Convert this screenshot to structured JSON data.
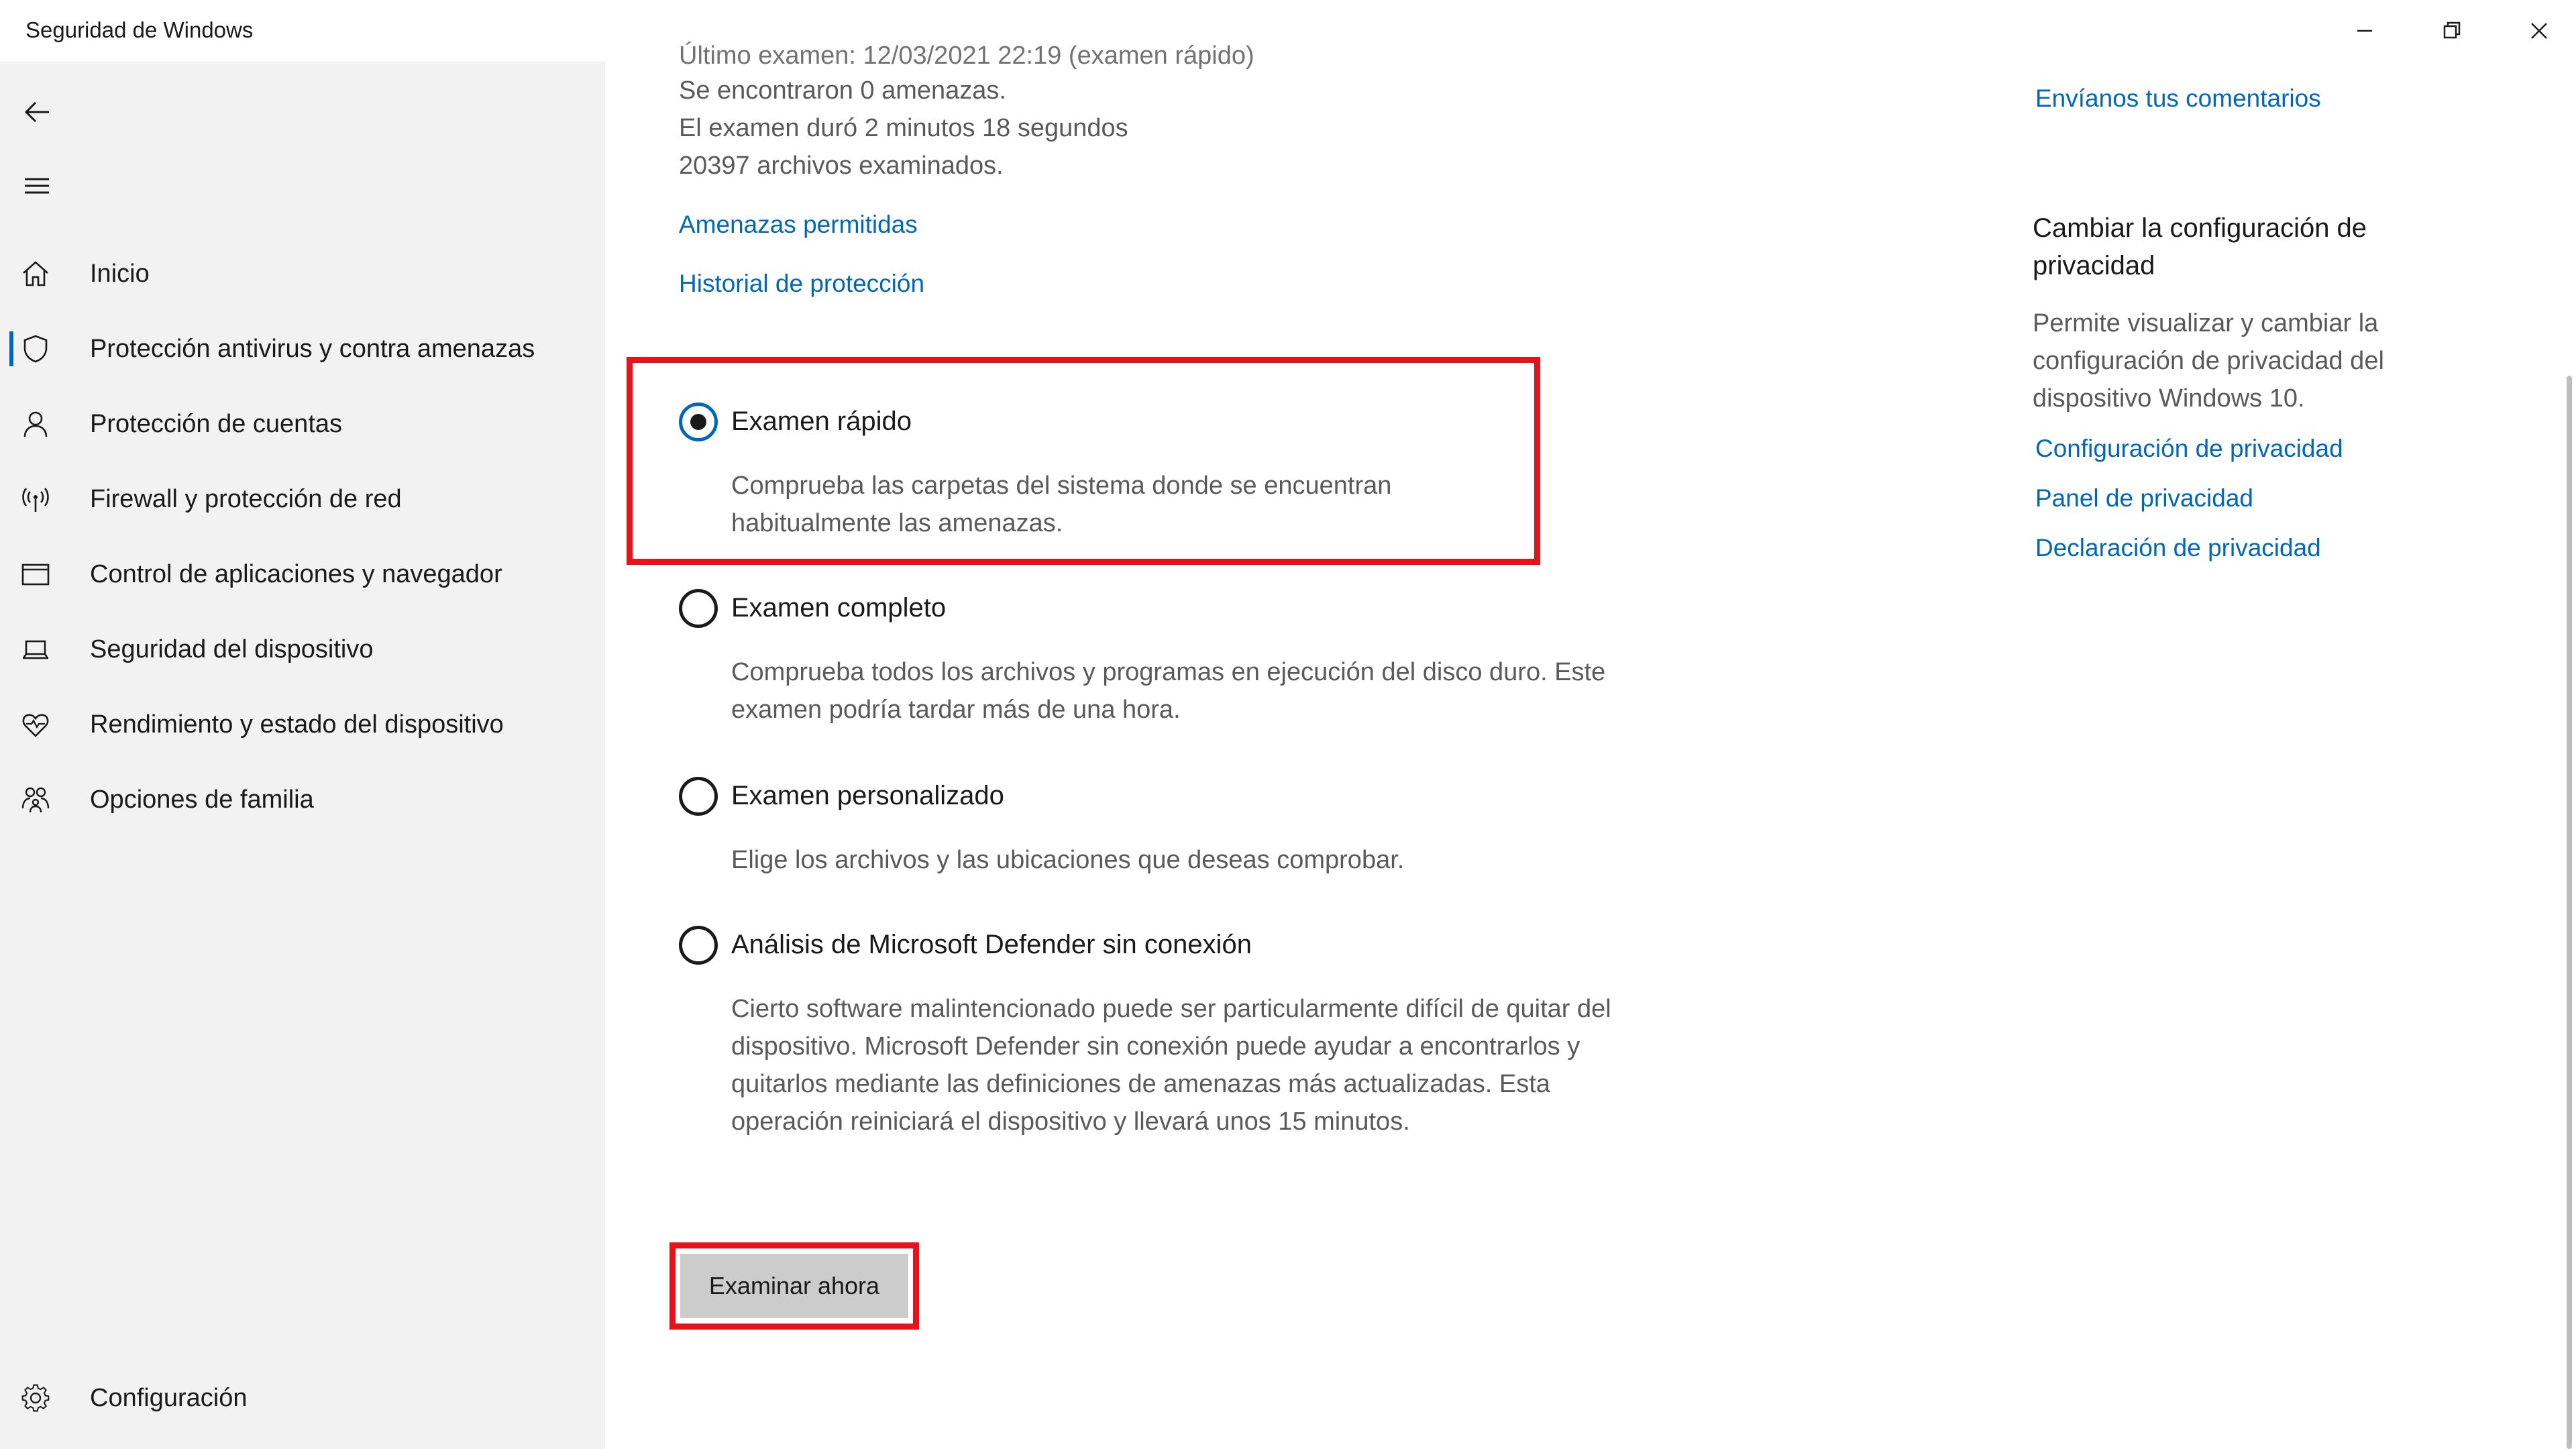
{
  "window": {
    "title": "Seguridad de Windows"
  },
  "sidebar": {
    "items": [
      {
        "label": "Inicio",
        "icon": "home-icon"
      },
      {
        "label": "Protección antivirus y contra amenazas",
        "icon": "shield-icon"
      },
      {
        "label": "Protección de cuentas",
        "icon": "person-icon"
      },
      {
        "label": "Firewall y protección de red",
        "icon": "wireless-icon"
      },
      {
        "label": "Control de aplicaciones y navegador",
        "icon": "browser-window-icon"
      },
      {
        "label": "Seguridad del dispositivo",
        "icon": "laptop-icon"
      },
      {
        "label": "Rendimiento y estado del dispositivo",
        "icon": "heart-pulse-icon"
      },
      {
        "label": "Opciones de familia",
        "icon": "family-icon"
      }
    ],
    "settings_label": "Configuración"
  },
  "main": {
    "scan_info": {
      "last_scan_partial": "Último examen: 12/03/2021 22:19 (examen rápido)",
      "threats_found": "Se encontraron 0 amenazas.",
      "duration": "El examen duró 2 minutos 18 segundos",
      "files_scanned": "20397 archivos examinados."
    },
    "links": {
      "allowed_threats": "Amenazas permitidas",
      "protection_history": "Historial de protección"
    },
    "options": [
      {
        "label": "Examen rápido",
        "description": "Comprueba las carpetas del sistema donde se encuentran habitualmente las amenazas.",
        "selected": true
      },
      {
        "label": "Examen completo",
        "description": "Comprueba todos los archivos y programas en ejecución del disco duro. Este examen podría tardar más de una hora.",
        "selected": false
      },
      {
        "label": "Examen personalizado",
        "description": "Elige los archivos y las ubicaciones que deseas comprobar.",
        "selected": false
      },
      {
        "label": "Análisis de Microsoft Defender sin conexión",
        "description": "Cierto software malintencionado puede ser particularmente difícil de quitar del dispositivo. Microsoft Defender sin conexión puede ayudar a encontrarlos y quitarlos mediante las definiciones de amenazas más actualizadas. Esta operación reiniciará el dispositivo y llevará unos 15 minutos.",
        "selected": false
      }
    ],
    "scan_button_label": "Examinar ahora"
  },
  "right_panel": {
    "feedback_link": "Envíanos tus comentarios",
    "privacy_heading": "Cambiar la configuración de privacidad",
    "privacy_description": "Permite visualizar y cambiar la configuración de privacidad del dispositivo Windows 10.",
    "privacy_links": [
      "Configuración de privacidad",
      "Panel de privacidad",
      "Declaración de privacidad"
    ]
  },
  "colors": {
    "accent": "#0067c0",
    "highlight": "#e8121b",
    "sidebar_bg": "#f2f2f2",
    "button_bg": "#cccccc"
  }
}
